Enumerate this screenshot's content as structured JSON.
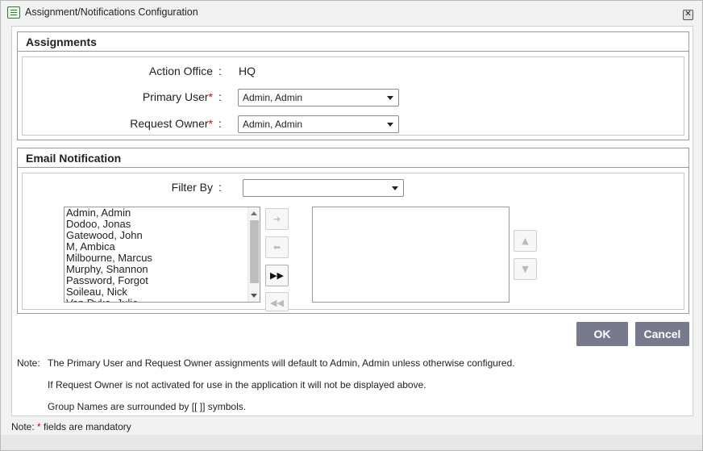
{
  "window": {
    "title": "Assignment/Notifications Configuration",
    "close_glyph": "✕"
  },
  "assignments": {
    "legend": "Assignments",
    "action_office": {
      "label": "Action Office",
      "colon": ":",
      "value": "HQ"
    },
    "primary_user": {
      "label": "Primary User",
      "required_mark": "*",
      "colon": ":",
      "value": "Admin, Admin"
    },
    "request_owner": {
      "label": "Request Owner",
      "required_mark": "*",
      "colon": ":",
      "value": "Admin, Admin"
    }
  },
  "email_notification": {
    "legend": "Email Notification",
    "filter_by": {
      "label": "Filter By",
      "colon": ":",
      "value": ""
    },
    "available_users": [
      "Admin, Admin",
      "Dodoo, Jonas",
      "Gatewood, John",
      "M, Ambica",
      "Milbourne, Marcus",
      "Murphy, Shannon",
      "Password, Forgot",
      "Soileau, Nick",
      "Van Dyke, Julie"
    ],
    "selected_users": [],
    "move_buttons": {
      "add_one": "➔",
      "remove_one": "⬅",
      "add_all": "▶▶",
      "remove_all": "◀◀"
    },
    "order_buttons": {
      "up": "▲",
      "down": "▼"
    }
  },
  "actions": {
    "ok_label": "OK",
    "cancel_label": "Cancel"
  },
  "notes": {
    "prefix": "Note:",
    "line1": "The Primary User and Request Owner assignments will default to Admin, Admin unless otherwise configured.",
    "line2": "If Request Owner is not activated for use in the application it will not be displayed above.",
    "line3": "Group Names are surrounded by [[ ]] symbols."
  },
  "footer": {
    "prefix": "Note:",
    "required_mark": "*",
    "text": "fields are mandatory"
  },
  "colors": {
    "button_bg": "#777a8c",
    "required": "#dd0000"
  }
}
